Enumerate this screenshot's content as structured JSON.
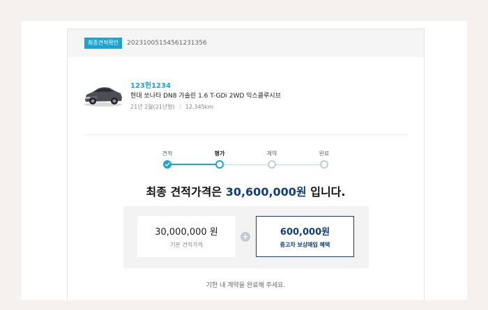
{
  "header": {
    "badge": "최종견적확인",
    "quote_number": "20231005154561231356"
  },
  "vehicle": {
    "plate": "123헌1234",
    "model": "현대 쏘나타 DN8 가솔린 1.6 T-GDi 2WD 익스클루시브",
    "year": "21년 2월(21년형)",
    "mileage": "12,345km"
  },
  "steps": [
    {
      "label": "견적",
      "state": "done"
    },
    {
      "label": "평가",
      "state": "current"
    },
    {
      "label": "계약",
      "state": "todo"
    },
    {
      "label": "완료",
      "state": "todo"
    }
  ],
  "final": {
    "prefix": "최종 견적가격은",
    "amount": "30,600,000원",
    "suffix": "입니다."
  },
  "price": {
    "base_value": "30,000,000 원",
    "base_label": "기본 견적가격",
    "plus_symbol": "+",
    "bonus_value": "600,000원",
    "bonus_label": "중고차 보상매입 혜택"
  },
  "footer": {
    "note": "기한 내 계약을 완료해 주세요."
  },
  "colors": {
    "accent": "#1aa3d4",
    "navy": "#0e3e7d"
  }
}
